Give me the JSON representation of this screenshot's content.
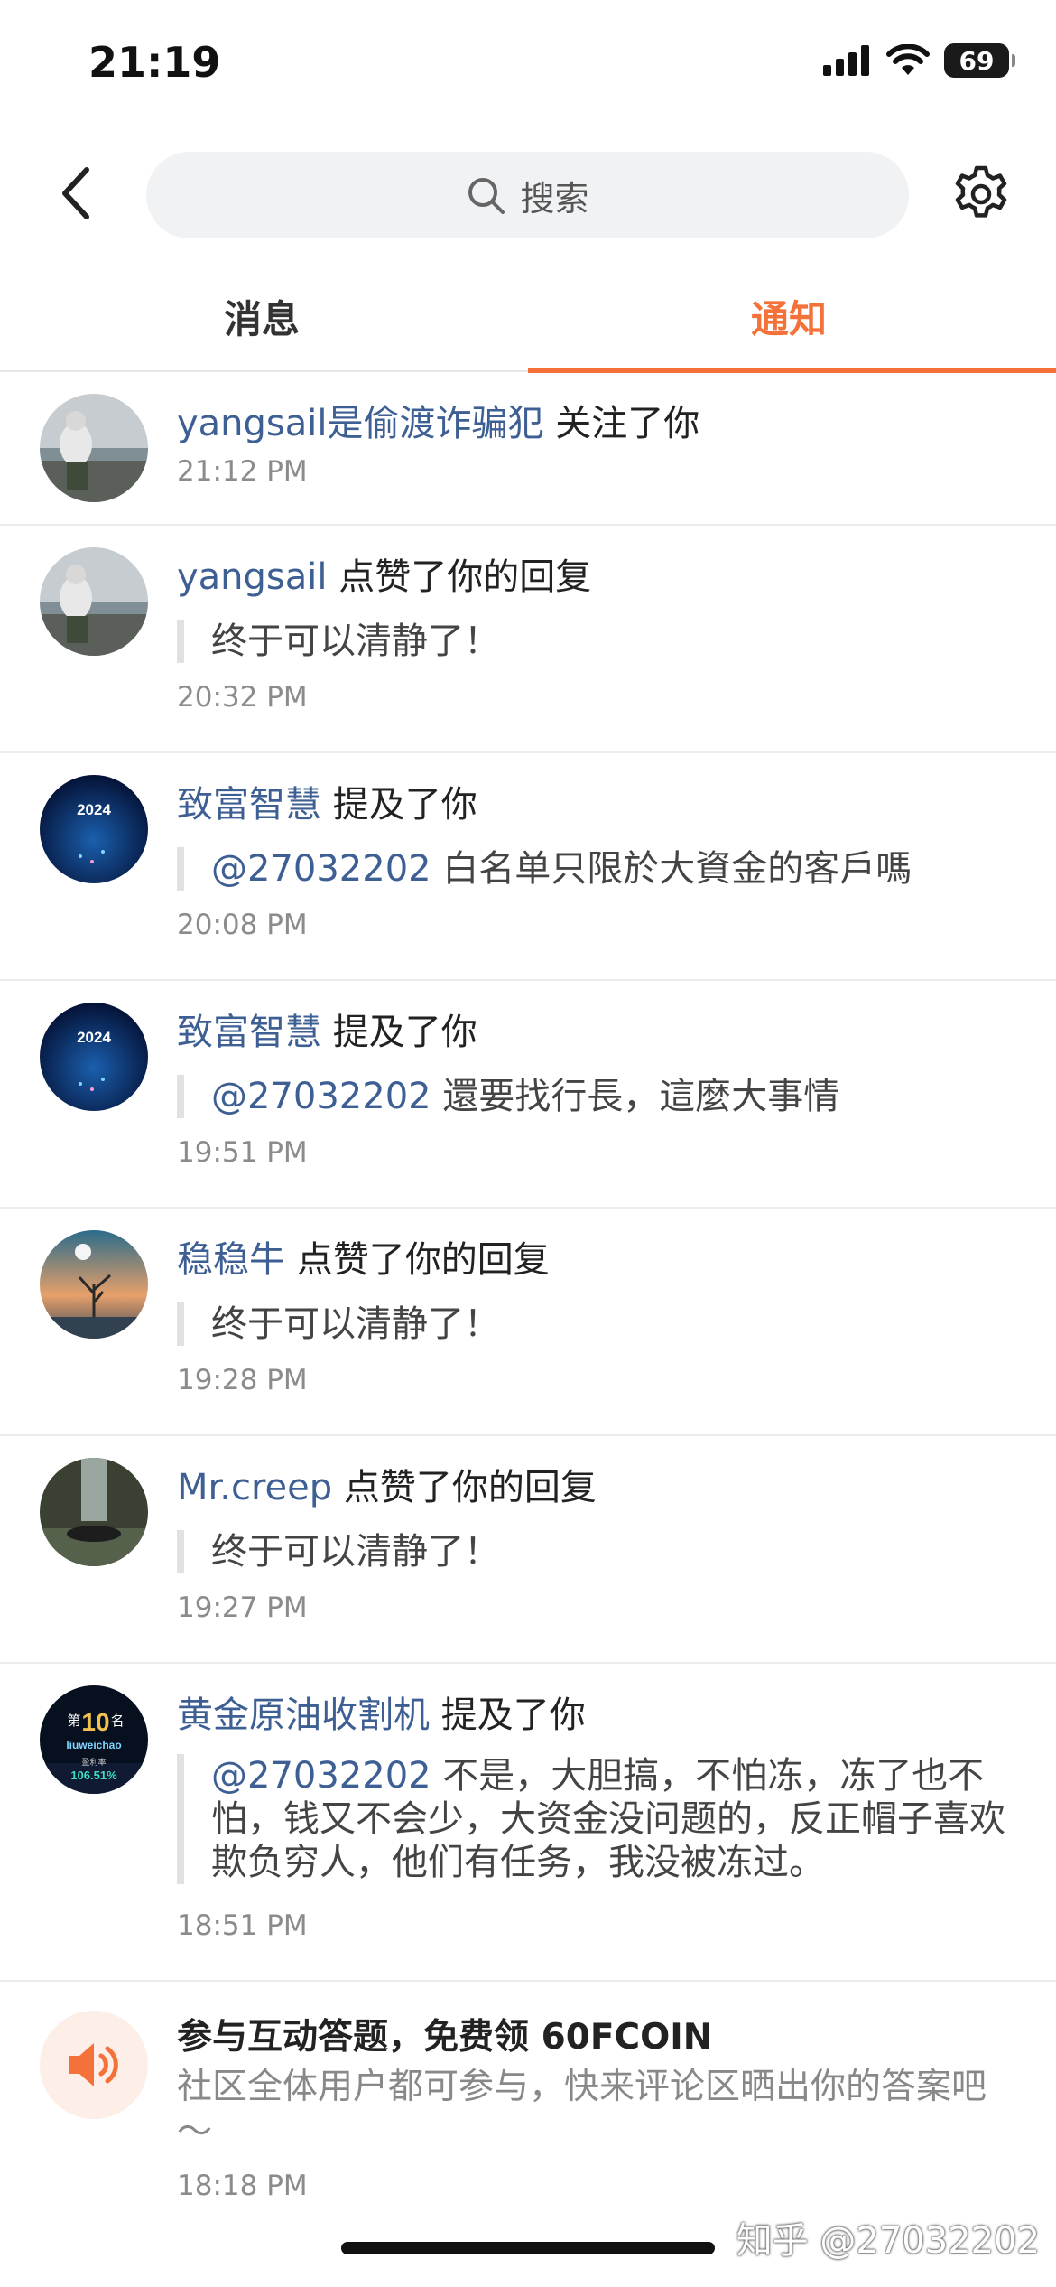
{
  "status_bar": {
    "time": "21:19",
    "battery": "69"
  },
  "search": {
    "placeholder": "搜索"
  },
  "tabs": [
    {
      "label": "消息",
      "active": false
    },
    {
      "label": "通知",
      "active": true
    }
  ],
  "accent_color": "#f4723a",
  "username_color": "#3e5f93",
  "notifications": [
    {
      "user": "yangsail是偷渡诈骗犯",
      "action": "关注了你",
      "quote_mention": "",
      "quote": "",
      "time": "21:12 PM"
    },
    {
      "user": "yangsail",
      "action": "点赞了你的回复",
      "quote_mention": "",
      "quote": "终于可以清静了！",
      "time": "20:32 PM"
    },
    {
      "user": "致富智慧",
      "action": "提及了你",
      "quote_mention": "@27032202",
      "quote": "白名单只限於大資金的客戶嗎",
      "time": "20:08 PM"
    },
    {
      "user": "致富智慧",
      "action": "提及了你",
      "quote_mention": "@27032202",
      "quote": "還要找行長，這麼大事情",
      "time": "19:51 PM"
    },
    {
      "user": "稳稳牛",
      "action": "点赞了你的回复",
      "quote_mention": "",
      "quote": "终于可以清静了！",
      "time": "19:28 PM"
    },
    {
      "user": "Mr.creep",
      "action": "点赞了你的回复",
      "quote_mention": "",
      "quote": "终于可以清静了！",
      "time": "19:27 PM"
    },
    {
      "user": "黄金原油收割机",
      "action": "提及了你",
      "quote_mention": "@27032202",
      "quote": "不是，大胆搞，不怕冻，冻了也不怕，钱又不会少，大资金没问题的，反正帽子喜欢欺负穷人，他们有任务，我没被冻过。",
      "time": "18:51 PM"
    }
  ],
  "avatar_text": {
    "year_2024": "2024",
    "rank_top": "第",
    "rank_num": "10",
    "rank_suffix": "名",
    "rank_name": "liuweichao",
    "rank_label": "盈利率",
    "rank_pct": "106.51%"
  },
  "promo": {
    "title": "参与互动答题，免费领 60FCOIN",
    "desc": "社区全体用户都可参与，快来评论区晒出你的答案吧～",
    "time": "18:18 PM",
    "icon": "speaker-icon"
  },
  "watermark": "知乎 @27032202"
}
